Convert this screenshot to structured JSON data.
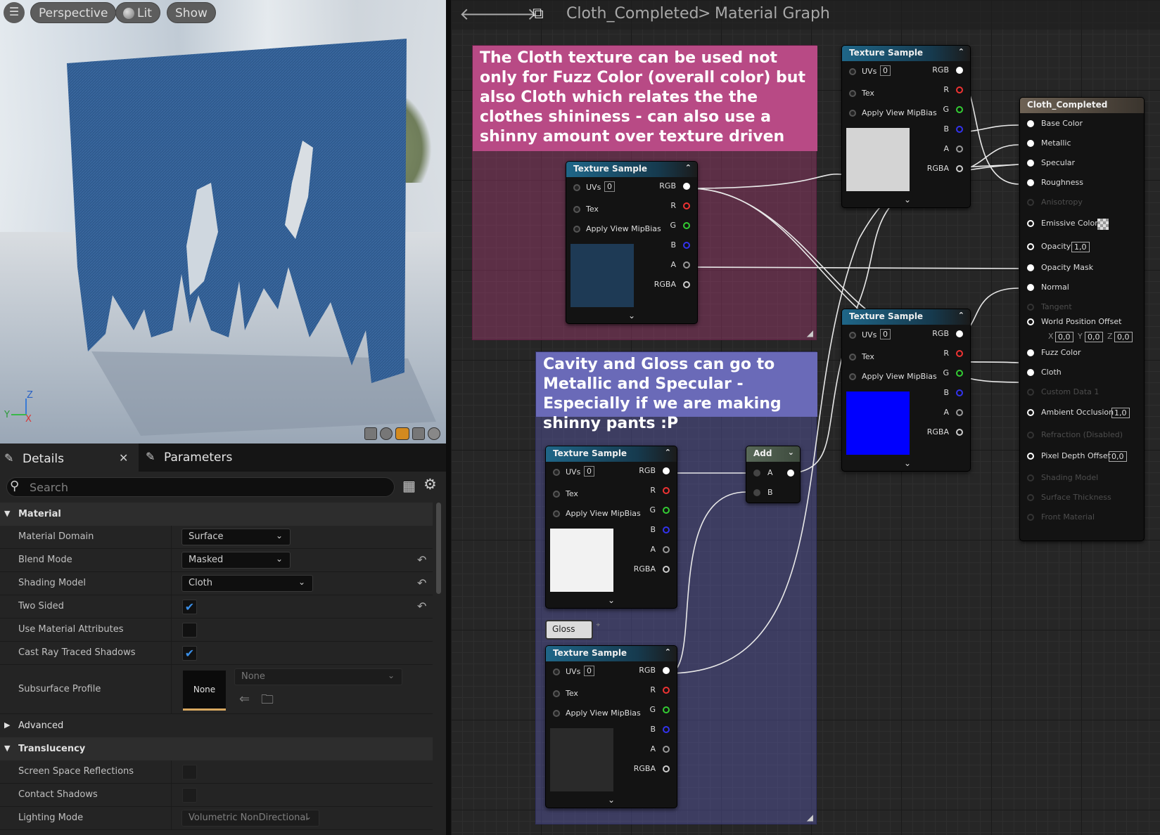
{
  "viewport": {
    "menu_icon": "hamburger-icon",
    "perspective_label": "Perspective",
    "lit_label": "Lit",
    "show_label": "Show",
    "axis_z": "Z",
    "axis_y": "Y",
    "axis_x": "X"
  },
  "details": {
    "tab_details": "Details",
    "tab_parameters": "Parameters",
    "search_placeholder": "Search",
    "section_material": "Material",
    "rows": {
      "material_domain": {
        "label": "Material Domain",
        "value": "Surface"
      },
      "blend_mode": {
        "label": "Blend Mode",
        "value": "Masked"
      },
      "shading_model": {
        "label": "Shading Model",
        "value": "Cloth"
      },
      "two_sided": {
        "label": "Two Sided",
        "checked": true
      },
      "use_material_attributes": {
        "label": "Use Material Attributes",
        "checked": false
      },
      "cast_ray_traced_shadows": {
        "label": "Cast Ray Traced Shadows",
        "checked": true
      },
      "subsurface_profile": {
        "label": "Subsurface Profile",
        "thumb": "None",
        "value": "None"
      }
    },
    "section_advanced": "Advanced",
    "section_translucency": "Translucency",
    "translucency_rows": {
      "ssr": {
        "label": "Screen Space Reflections",
        "checked": false
      },
      "contact_shadows": {
        "label": "Contact Shadows",
        "checked": false
      },
      "lighting_mode": {
        "label": "Lighting Mode",
        "value": "Volumetric NonDirectional"
      }
    }
  },
  "graph": {
    "breadcrumb_asset": "Cloth_Completed",
    "breadcrumb_sep": ">",
    "breadcrumb_graph": "Material Graph",
    "comment1": "The Cloth texture can be used not only for Fuzz Color (overall color) but also Cloth which relates the the clothes shininess - can also use a shinny amount over texture driven",
    "comment2": "Cavity and Gloss can go to Metallic and Specular - Especially if we are making shinny pants :P",
    "texture_sample_title": "Texture Sample",
    "pin_uvs": "UVs",
    "pin_uvs_value": "0",
    "pin_tex": "Tex",
    "pin_mip": "Apply View MipBias",
    "pin_rgb": "RGB",
    "pin_r": "R",
    "pin_g": "G",
    "pin_b": "B",
    "pin_a": "A",
    "pin_rgba": "RGBA",
    "add_title": "Add",
    "add_a": "A",
    "add_b": "B",
    "gloss_label": "Gloss",
    "material_node": {
      "title": "Cloth_Completed",
      "pins": [
        "Base Color",
        "Metallic",
        "Specular",
        "Roughness",
        "Anisotropy",
        "Emissive Color",
        "Opacity",
        "Opacity Mask",
        "Normal",
        "Tangent",
        "World Position Offset",
        "Fuzz Color",
        "Cloth",
        "Custom Data 1",
        "Ambient Occlusion",
        "Refraction (Disabled)",
        "Pixel Depth Offset",
        "Shading Model",
        "Surface Thickness",
        "Front Material"
      ],
      "opacity_value": "1,0",
      "wpo_x_label": "X",
      "wpo_x": "0,0",
      "wpo_y_label": "Y",
      "wpo_y": "0,0",
      "wpo_z_label": "Z",
      "wpo_z": "0,0",
      "ao_value": "1,0",
      "pdo_value": "0,0"
    }
  }
}
